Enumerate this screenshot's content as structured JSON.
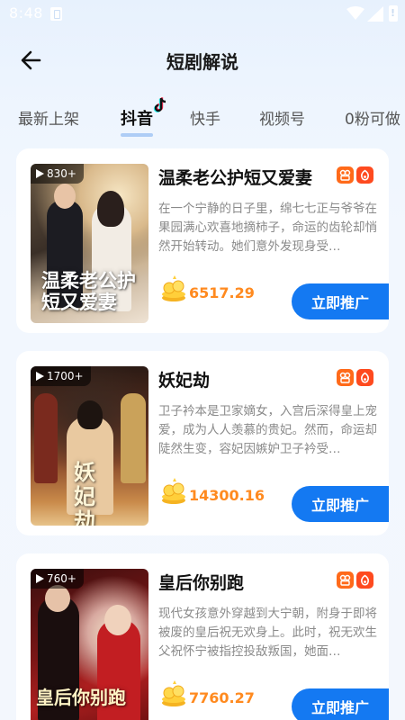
{
  "status_bar": {
    "time": "8:48"
  },
  "header": {
    "title": "短剧解说"
  },
  "tabs": [
    {
      "label": "最新上架"
    },
    {
      "label": "抖音"
    },
    {
      "label": "快手"
    },
    {
      "label": "视频号"
    },
    {
      "label": "0粉可做"
    }
  ],
  "active_tab": "抖音",
  "dramas": [
    {
      "title": "温柔老公护短又爱妻",
      "views": "830+",
      "poster_text": "温柔老公护短又爱妻",
      "description": "在一个宁静的日子里，绵七七正与爷爷在果园满心欢喜地摘柿子，命运的齿轮却悄然开始转动。她们意外发现身受…",
      "amount": "6517.29",
      "button": "立即推广"
    },
    {
      "title": "妖妃劫",
      "views": "1700+",
      "poster_text": "妖妃劫",
      "description": "卫子衿本是卫家嫡女，入宫后深得皇上宠爱，成为人人羡慕的贵妃。然而，命运却陡然生变，容妃因嫉妒卫子衿受…",
      "amount": "14300.16",
      "button": "立即推广"
    },
    {
      "title": "皇后你别跑",
      "views": "760+",
      "poster_text": "皇后你别跑",
      "description": "现代女孩意外穿越到大宁朝，附身于即将被废的皇后祝无欢身上。此时，祝无欢生父祝怀宁被指控投敌叛国，她面…",
      "amount": "7760.27",
      "button": "立即推广"
    }
  ],
  "colors": {
    "accent": "#1479f2",
    "amount": "#ff8a1f",
    "background": "#eef5fe",
    "kuaishou": "#ff6a1a",
    "douyin": "#fe4a1f"
  },
  "icons": {
    "back": "arrow-left-icon",
    "views": "play-icon",
    "coin": "coin-stack-icon",
    "platforms": [
      "kuaishou-icon",
      "douyin-icon"
    ]
  }
}
